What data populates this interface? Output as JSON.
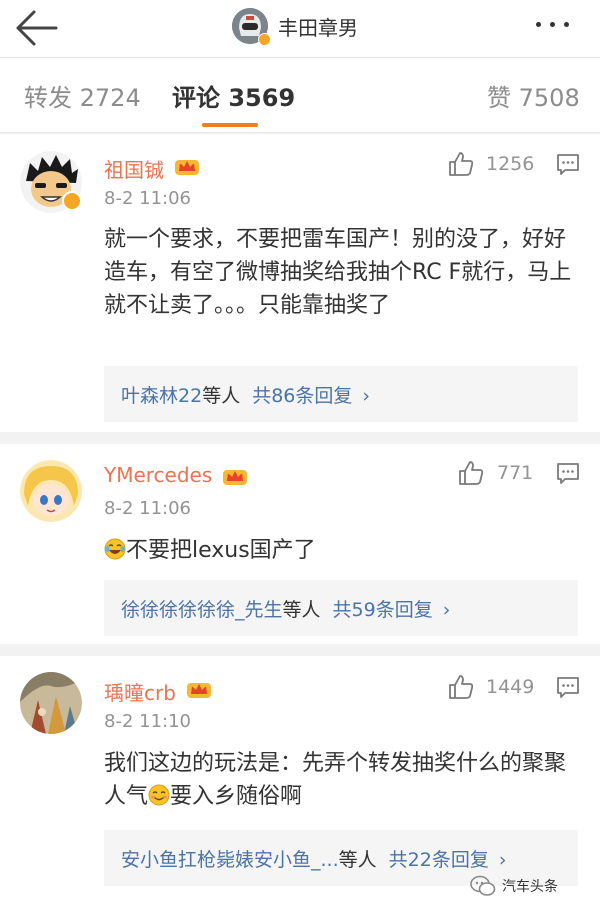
{
  "header": {
    "title": "丰田章男",
    "back_icon": "arrow-left-icon",
    "more_icon": "more-dots-icon"
  },
  "tabs": [
    {
      "label": "转发",
      "count": "2724",
      "active": false
    },
    {
      "label": "评论",
      "count": "3569",
      "active": true
    },
    {
      "label": "赞",
      "count": "7508",
      "active": false
    }
  ],
  "colors": {
    "accent": "#f07e1a",
    "username": "#eb7350",
    "reply_link": "#4a74a8",
    "meta": "#939393"
  },
  "comments": [
    {
      "username": "祖国铖",
      "time": "8-2 11:06",
      "likes": "1256",
      "verified": true,
      "text": "就一个要求，不要把雷车国产！别的没了，好好造车，有空了微博抽奖给我抽个RC F就行，马上就不让卖了。。。只能靠抽奖了",
      "reply_users": "叶森林22",
      "reply_suffix": "等人",
      "reply_count": "共86条回复",
      "reply_arrow": "›"
    },
    {
      "username": "YMercedes",
      "time": "8-2 11:06",
      "likes": "771",
      "verified": false,
      "emoji": "laugh-cry-emoji",
      "text": "不要把lexus国产了",
      "reply_users": "徐徐徐徐徐徐_先生",
      "reply_suffix": "等人",
      "reply_count": "共59条回复",
      "reply_arrow": "›"
    },
    {
      "username": "瑀曈crb",
      "time": "8-2 11:10",
      "likes": "1449",
      "verified": false,
      "text_part1": "我们这边的玩法是：先弄个转发抽奖什么的聚聚人气",
      "emoji": "smile-emoji",
      "text_part2": "要入乡随俗啊",
      "reply_users": "安小鱼扛枪毙婊安小鱼_...",
      "reply_suffix": "等人",
      "reply_count": "共22条回复",
      "reply_arrow": "›"
    }
  ],
  "watermark": {
    "text": "汽车头条"
  }
}
